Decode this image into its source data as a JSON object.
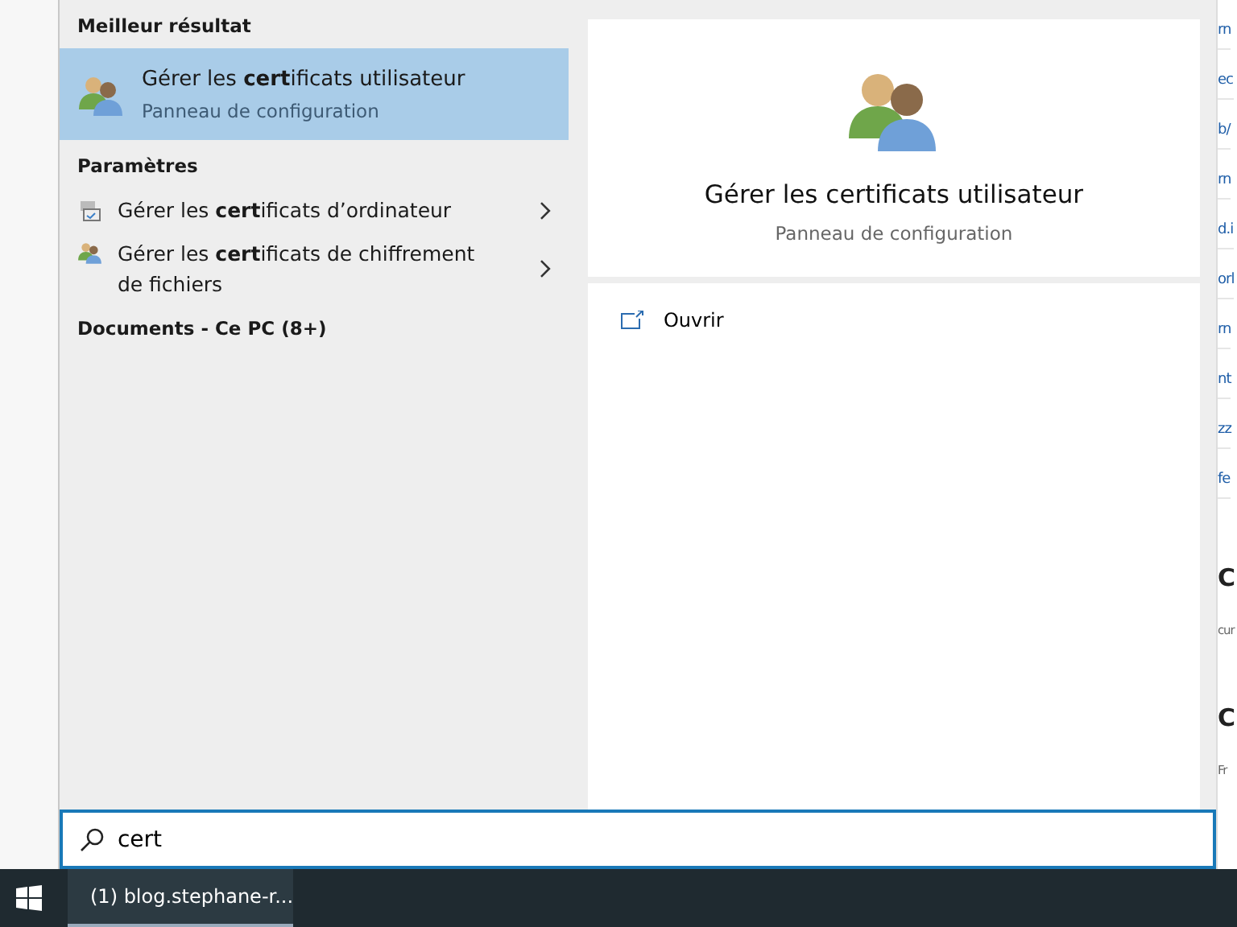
{
  "search_panel": {
    "best_match": {
      "heading": "Meilleur résultat",
      "item": {
        "title": "Gérer les **cert**ificats utilisateur",
        "subtitle": "Panneau de configuration",
        "selected": true
      }
    },
    "settings": {
      "heading": "Paramètres",
      "items": [
        {
          "title": "Gérer les **cert**ificats d’ordinateur",
          "kind": "computer",
          "selected": false
        },
        {
          "title": "Gérer les **cert**ificats de chiffrement de fichiers",
          "kind": "users",
          "selected": false
        }
      ]
    },
    "documents": {
      "heading": "Documents - Ce PC (8+)"
    },
    "preview": {
      "title": "Gérer les certificats utilisateur",
      "subtitle": "Panneau de configuration",
      "actions": [
        {
          "label": "Ouvrir"
        }
      ]
    }
  },
  "search_box": {
    "value": "cert"
  },
  "background_page": {
    "fragments": [
      {
        "text": "rn",
        "kind": "link"
      },
      {
        "text": "ec",
        "kind": "link"
      },
      {
        "text": "b/",
        "kind": "link"
      },
      {
        "text": "rn",
        "kind": "link"
      },
      {
        "text": "d.i",
        "kind": "link"
      },
      {
        "text": "orl",
        "kind": "link"
      },
      {
        "text": "rn",
        "kind": "link"
      },
      {
        "text": "nt",
        "kind": "link"
      },
      {
        "text": "zz",
        "kind": "link"
      },
      {
        "text": "fe",
        "kind": "link"
      },
      {
        "text": "C",
        "kind": "heading"
      },
      {
        "text": "cur",
        "kind": "text"
      },
      {
        "text": "C",
        "kind": "heading"
      },
      {
        "text": "Fr",
        "kind": "text"
      }
    ]
  },
  "taskbar": {
    "windows": [
      {
        "label": "(1) blog.stephane-r...",
        "active": true
      }
    ]
  }
}
